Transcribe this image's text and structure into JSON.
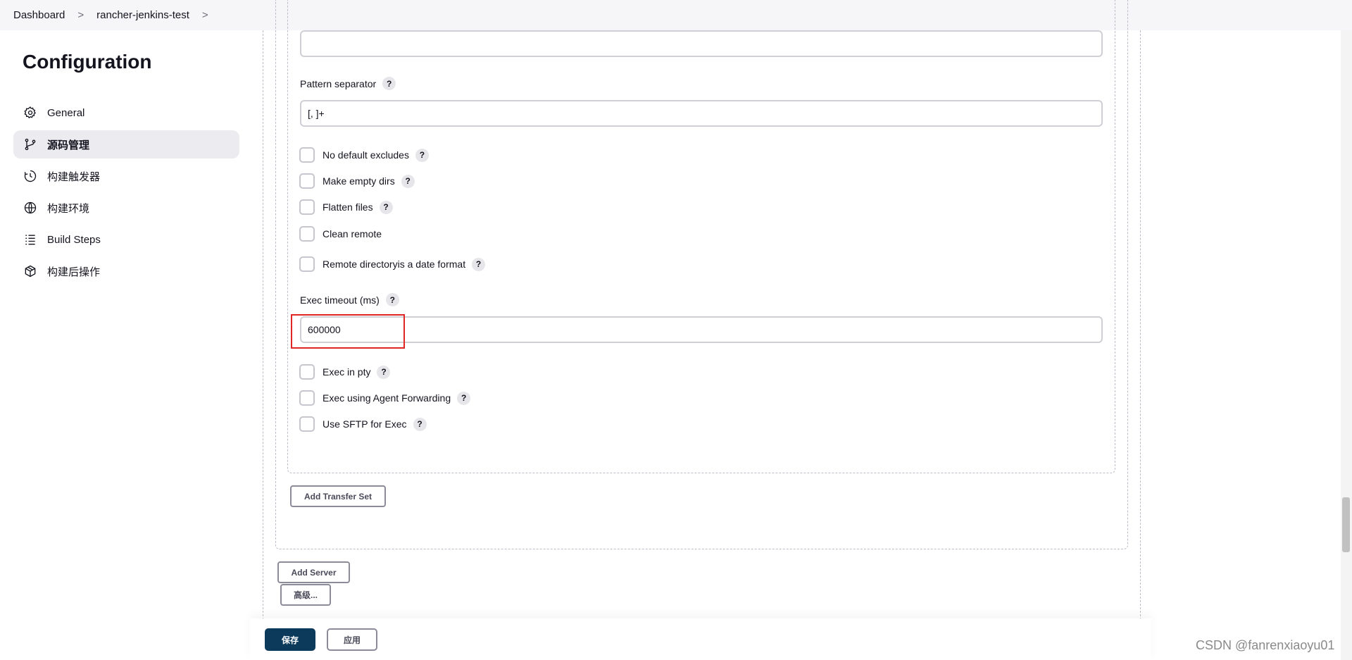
{
  "breadcrumb": {
    "items": [
      "Dashboard",
      "rancher-jenkins-test"
    ],
    "separator": ">"
  },
  "sidebar": {
    "title": "Configuration",
    "items": [
      {
        "label": "General",
        "icon": "gear-icon"
      },
      {
        "label": "源码管理",
        "icon": "branch-icon",
        "active": true
      },
      {
        "label": "构建触发器",
        "icon": "clock-icon"
      },
      {
        "label": "构建环境",
        "icon": "globe-icon"
      },
      {
        "label": "Build Steps",
        "icon": "list-icon"
      },
      {
        "label": "构建后操作",
        "icon": "package-icon"
      }
    ]
  },
  "form": {
    "top_input_value": "",
    "pattern_separator_label": "Pattern separator",
    "pattern_separator_value": "[, ]+",
    "checkboxes_1": [
      {
        "label": "No default excludes",
        "help": true,
        "checked": false
      },
      {
        "label": "Make empty dirs",
        "help": true,
        "checked": false
      },
      {
        "label": "Flatten files",
        "help": true,
        "checked": false
      },
      {
        "label": "Clean remote",
        "help": false,
        "checked": false
      },
      {
        "label": "Remote directoryis a date format",
        "help": true,
        "checked": false
      }
    ],
    "exec_timeout_label": "Exec timeout (ms)",
    "exec_timeout_value": "600000",
    "checkboxes_2": [
      {
        "label": "Exec in pty",
        "help": true,
        "checked": false
      },
      {
        "label": "Exec using Agent Forwarding",
        "help": true,
        "checked": false
      },
      {
        "label": "Use SFTP for Exec",
        "help": true,
        "checked": false
      }
    ],
    "help_glyph": "?"
  },
  "buttons": {
    "add_transfer_set": "Add Transfer Set",
    "add_server": "Add Server",
    "advanced": "高级...",
    "save": "保存",
    "apply": "应用"
  },
  "watermark": "CSDN @fanrenxiaoyu01",
  "colors": {
    "accent": "#0b3a5b",
    "highlight": "#e02525"
  }
}
